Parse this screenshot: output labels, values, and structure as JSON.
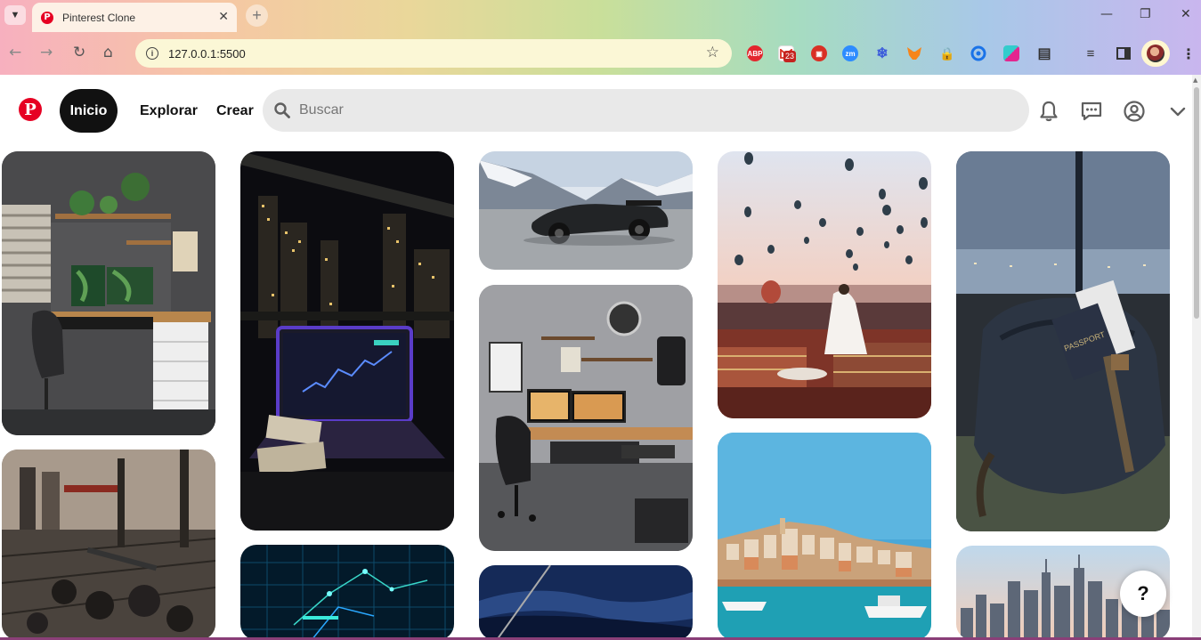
{
  "browser": {
    "tab_title": "Pinterest Clone",
    "url": "127.0.0.1:5500",
    "extensions": [
      "abp-icon",
      "gmail-icon",
      "extension-red-icon",
      "zoom-icon",
      "snowflake-icon",
      "metamask-icon",
      "lock-icon",
      "circle-c-icon",
      "colorful-ext-icon",
      "puzzle-icon",
      "playlist-icon",
      "sidebar-icon"
    ],
    "extension_abp_label": "ABP",
    "extension_zm_label": "zm",
    "gmail_badge": "23"
  },
  "header": {
    "logo_letter": "P",
    "nav": {
      "home": "Inicio",
      "explore": "Explorar",
      "create": "Crear"
    },
    "search_placeholder": "Buscar",
    "icons": [
      "bell-icon",
      "message-icon",
      "account-icon",
      "chevron-down-icon"
    ]
  },
  "pins": [
    {
      "name": "pin-desk-setup",
      "desc": "desk setup"
    },
    {
      "name": "pin-gym",
      "desc": "gym"
    },
    {
      "name": "pin-laptop-night",
      "desc": "laptop night city"
    },
    {
      "name": "pin-network",
      "desc": "network lines"
    },
    {
      "name": "pin-supercar",
      "desc": "supercar"
    },
    {
      "name": "pin-gaming-room",
      "desc": "gaming room"
    },
    {
      "name": "pin-night-sky",
      "desc": "night sky"
    },
    {
      "name": "pin-balloons",
      "desc": "hot air balloons"
    },
    {
      "name": "pin-harbor",
      "desc": "harbor town"
    },
    {
      "name": "pin-travel-bag",
      "desc": "travel bag passport"
    },
    {
      "name": "pin-city-skyline",
      "desc": "city skyline"
    }
  ],
  "help_label": "?",
  "passport_text": "PASSPORT",
  "colors": {
    "brand": "#e60023",
    "home_bg": "#111111",
    "search_bg": "#e9e9e9"
  }
}
